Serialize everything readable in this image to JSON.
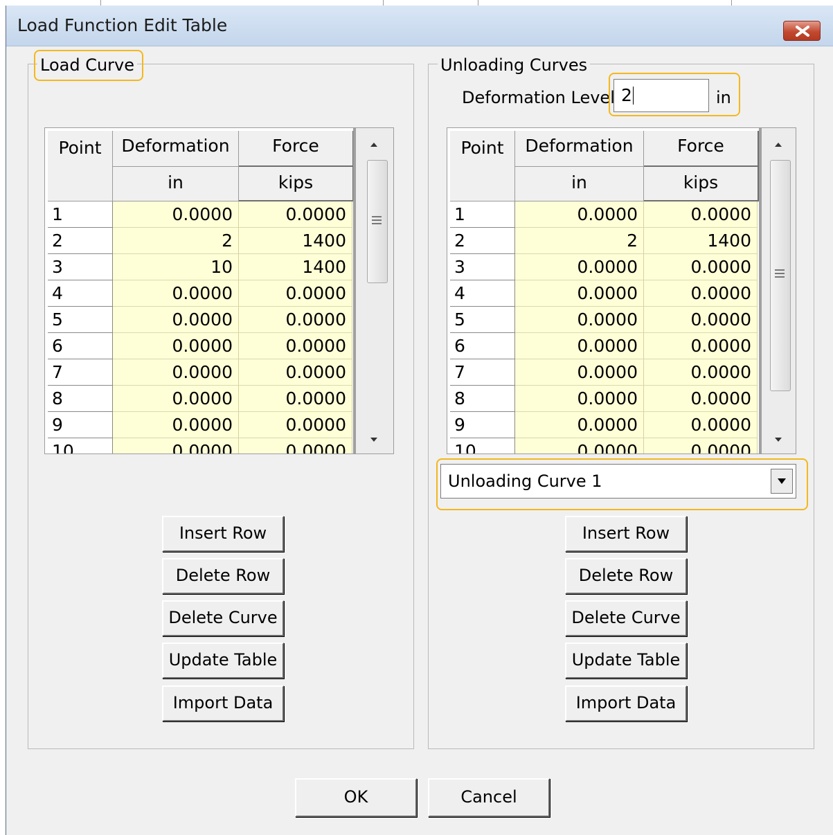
{
  "window": {
    "title": "Load Function Edit Table"
  },
  "load_curve": {
    "legend": "Load Curve",
    "headers": {
      "point": "Point",
      "deformation": "Deformation",
      "force": "Force",
      "deformation_unit": "in",
      "force_unit": "kips"
    },
    "rows": [
      {
        "point": "1",
        "deformation": "0.0000",
        "force": "0.0000"
      },
      {
        "point": "2",
        "deformation": "2",
        "force": "1400"
      },
      {
        "point": "3",
        "deformation": "10",
        "force": "1400"
      },
      {
        "point": "4",
        "deformation": "0.0000",
        "force": "0.0000"
      },
      {
        "point": "5",
        "deformation": "0.0000",
        "force": "0.0000"
      },
      {
        "point": "6",
        "deformation": "0.0000",
        "force": "0.0000"
      },
      {
        "point": "7",
        "deformation": "0.0000",
        "force": "0.0000"
      },
      {
        "point": "8",
        "deformation": "0.0000",
        "force": "0.0000"
      },
      {
        "point": "9",
        "deformation": "0.0000",
        "force": "0.0000"
      },
      {
        "point": "10",
        "deformation": "0.0000",
        "force": "0.0000"
      }
    ],
    "buttons": {
      "insert_row": "Insert Row",
      "delete_row": "Delete Row",
      "delete_curve": "Delete Curve",
      "update_table": "Update Table",
      "import_data": "Import Data"
    }
  },
  "unloading_curves": {
    "legend": "Unloading Curves",
    "deformation_level_label": "Deformation Level",
    "deformation_level_value": "2",
    "deformation_level_unit": "in",
    "headers": {
      "point": "Point",
      "deformation": "Deformation",
      "force": "Force",
      "deformation_unit": "in",
      "force_unit": "kips"
    },
    "rows": [
      {
        "point": "1",
        "deformation": "0.0000",
        "force": "0.0000"
      },
      {
        "point": "2",
        "deformation": "2",
        "force": "1400"
      },
      {
        "point": "3",
        "deformation": "0.0000",
        "force": "0.0000"
      },
      {
        "point": "4",
        "deformation": "0.0000",
        "force": "0.0000"
      },
      {
        "point": "5",
        "deformation": "0.0000",
        "force": "0.0000"
      },
      {
        "point": "6",
        "deformation": "0.0000",
        "force": "0.0000"
      },
      {
        "point": "7",
        "deformation": "0.0000",
        "force": "0.0000"
      },
      {
        "point": "8",
        "deformation": "0.0000",
        "force": "0.0000"
      },
      {
        "point": "9",
        "deformation": "0.0000",
        "force": "0.0000"
      },
      {
        "point": "10",
        "deformation": "0.0000",
        "force": "0.0000"
      }
    ],
    "curve_select": {
      "selected": "Unloading Curve 1"
    },
    "buttons": {
      "insert_row": "Insert Row",
      "delete_row": "Delete Row",
      "delete_curve": "Delete Curve",
      "update_table": "Update Table",
      "import_data": "Import Data"
    }
  },
  "footer": {
    "ok": "OK",
    "cancel": "Cancel"
  },
  "colors": {
    "highlight": "#f3b81d",
    "cell_background": "#ffffd7",
    "dialog_background": "#f0f0f0"
  }
}
